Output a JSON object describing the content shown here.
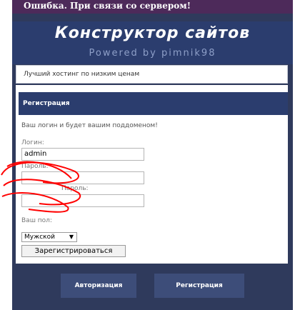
{
  "error": "Ошибка. При связи со сервером!",
  "header": {
    "logo": "Конструктор сайтов",
    "powered": "Powered by pimnik98"
  },
  "tagline": "Лучший хостинг по низким ценам",
  "registration": {
    "title": "Регистрация",
    "hint": "Ваш логин и будет вашим поддоменом!",
    "login_label": "Логин:",
    "login_value": "admin",
    "password_label": "Пароль:",
    "password2_label": "Пароль:",
    "sex_label": "Ваш пол:",
    "sex_value": "Мужской",
    "submit_label": "Зарегистрироваться"
  },
  "footer": {
    "auth_label": "Авторизация",
    "reg_label": "Регистрация"
  },
  "colors": {
    "frame": "#2f3a5c",
    "header": "#2b3d6e",
    "error_bar": "#4d2a5a",
    "scribble": "#ff0000"
  }
}
